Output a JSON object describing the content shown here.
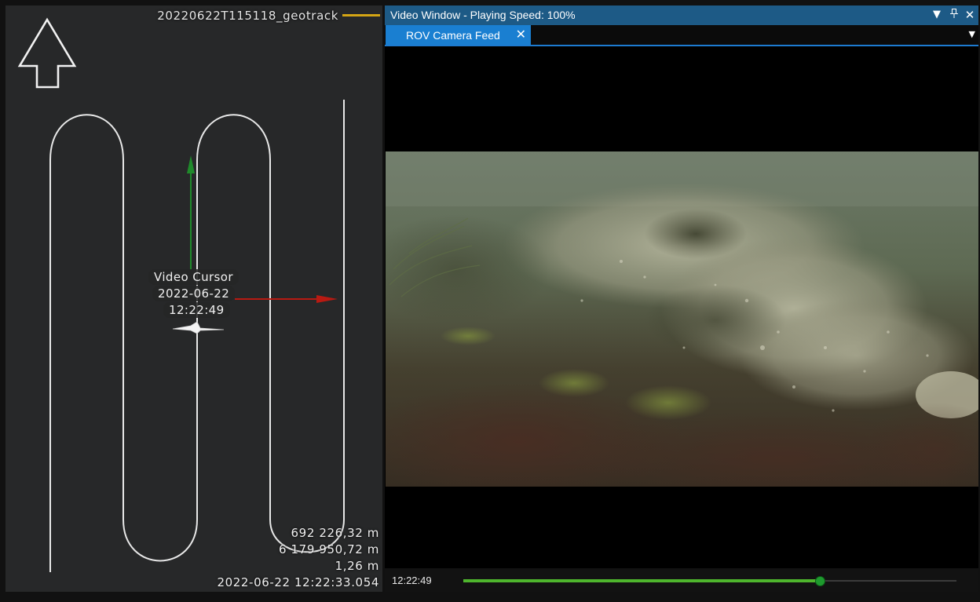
{
  "map": {
    "track_name": "20220622T115118_geotrack",
    "track_color": "#d4a514",
    "north_arrow_icon": "north-arrow-icon",
    "cursor": {
      "title": "Video Cursor",
      "date": "2022-06-22",
      "time": "12:22:49"
    },
    "readout": {
      "easting": "692 226,32 m",
      "northing": "6 179 950,72 m",
      "depth": "1,26 m",
      "timestamp": "2022-06-22 12:22:33.054"
    },
    "axis_colors": {
      "y": "#1f8a2a",
      "x": "#b81a12"
    }
  },
  "video_window": {
    "title": "Video Window - Playing Speed: 100%",
    "buttons": {
      "menu_icon": "dropdown-icon",
      "pin_icon": "pin-icon",
      "close_icon": "close-icon"
    },
    "tab": {
      "label": "ROV Camera Feed",
      "close_icon": "close-icon"
    },
    "tab_dropdown_icon": "dropdown-icon",
    "accent_color": "#1a7fd1",
    "titlebar_color": "#1d5a86",
    "playback": {
      "current_time": "12:22:49",
      "progress_fraction": 0.721,
      "progress_color": "#4eb52d"
    }
  }
}
